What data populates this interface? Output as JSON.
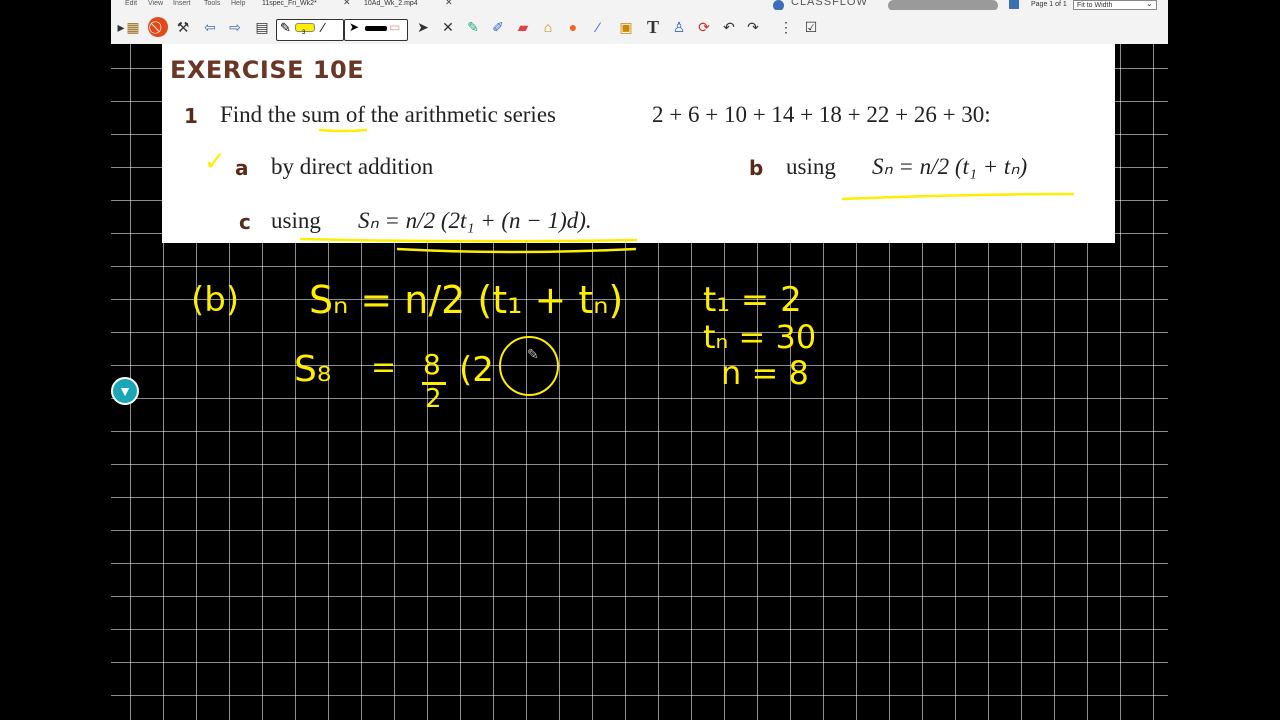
{
  "menu": [
    "Edit",
    "View",
    "Insert",
    "Tools",
    "Help"
  ],
  "tabs": [
    {
      "label": "11spec_Fri_Wk2*",
      "close": "✕"
    },
    {
      "label": "10Ad_Wk_2.mp4",
      "close": "✕"
    }
  ],
  "brand": "CLASSFLOW",
  "page_info": "Page 1 of 1",
  "zoom": "Fit to Width",
  "toolbar_icons": [
    "pointer-icon",
    "tools-icon",
    "pen-icon",
    "highlighter-icon",
    "eraser-icon",
    "fill-icon",
    "shapes-icon",
    "connector-icon",
    "clipart-icon",
    "text-icon",
    "spray-icon",
    "reset-icon",
    "undo-icon",
    "redo-icon",
    "more-icon",
    "record-icon"
  ],
  "pen_width": "3",
  "exercise": {
    "title": "EXERCISE 10E",
    "number": "1",
    "question": "Find the sum of the arithmetic series",
    "series": "2 + 6 + 10 + 14 + 18 + 22 + 26 + 30:",
    "part_a_letter": "a",
    "part_a": "by direct addition",
    "part_b_letter": "b",
    "part_b": "using",
    "part_b_formula": "Sₙ = n/2 (t₁ + tₙ)",
    "part_c_letter": "c",
    "part_c": "using",
    "part_c_formula": "Sₙ = n/2 (2t₁ + (n − 1)d)."
  },
  "handwriting": {
    "label": "(b)",
    "formula": "Sₙ = n/2 (t₁ + tₙ)",
    "work_lhs": "S₈",
    "work_eq": "=",
    "work_frac_num": "8",
    "work_frac_den": "2",
    "work_rest": "(2",
    "given_1": "t₁ = 2",
    "given_2": "tₙ = 30",
    "given_3": "n = 8",
    "check": "✓"
  },
  "colors": {
    "ink": "#ffee00",
    "heading": "#6a3727",
    "accent": "#1aa6b7"
  }
}
